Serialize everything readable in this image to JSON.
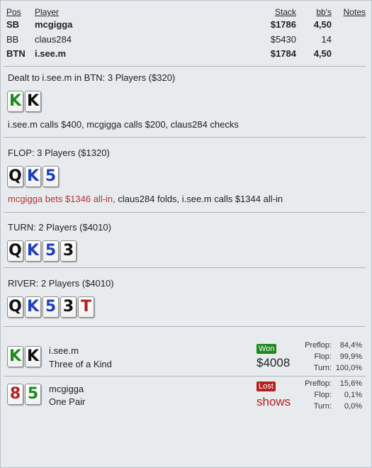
{
  "colors": {
    "spade": "#111111",
    "club": "#1d8a1d",
    "heart": "#b52020",
    "diamond": "#1f41b8",
    "won": "#1d8a1d",
    "lost": "#b52020",
    "red_action": "#b83232"
  },
  "table": {
    "headers": {
      "pos": "Pos",
      "player": "Player",
      "stack": "Stack",
      "bbs": "bb's",
      "notes": "Notes"
    },
    "rows": [
      {
        "pos": "SB",
        "player": "mcgigga",
        "stack": "$1786",
        "bbs": "4,50",
        "bold": true
      },
      {
        "pos": "BB",
        "player": "claus284",
        "stack": "$5430",
        "bbs": "14",
        "bold": false
      },
      {
        "pos": "BTN",
        "player": "i.see.m",
        "stack": "$1784",
        "bbs": "4,50",
        "bold": true
      }
    ]
  },
  "preflop": {
    "title": "Dealt to i.see.m in BTN: 3 Players ($320)",
    "cards": [
      {
        "rank": "K",
        "suit": "club"
      },
      {
        "rank": "K",
        "suit": "spade"
      }
    ],
    "action": "i.see.m calls $400, mcgigga calls $200, claus284 checks"
  },
  "flop": {
    "title": "FLOP: 3 Players ($1320)",
    "cards": [
      {
        "rank": "Q",
        "suit": "spade"
      },
      {
        "rank": "K",
        "suit": "diamond"
      },
      {
        "rank": "5",
        "suit": "diamond"
      }
    ],
    "action_red": "mcgigga bets $1346 all-in,",
    "action_rest": " claus284 folds, i.see.m calls $1344 all-in"
  },
  "turn": {
    "title": "TURN: 2 Players ($4010)",
    "cards": [
      {
        "rank": "Q",
        "suit": "spade"
      },
      {
        "rank": "K",
        "suit": "diamond"
      },
      {
        "rank": "5",
        "suit": "diamond"
      },
      {
        "rank": "3",
        "suit": "spade"
      }
    ]
  },
  "river": {
    "title": "RIVER: 2 Players ($4010)",
    "cards": [
      {
        "rank": "Q",
        "suit": "spade"
      },
      {
        "rank": "K",
        "suit": "diamond"
      },
      {
        "rank": "5",
        "suit": "diamond"
      },
      {
        "rank": "3",
        "suit": "spade"
      },
      {
        "rank": "T",
        "suit": "heart"
      }
    ]
  },
  "summary": [
    {
      "name": "i.see.m",
      "hand": "Three of a Kind",
      "cards": [
        {
          "rank": "K",
          "suit": "club"
        },
        {
          "rank": "K",
          "suit": "spade"
        }
      ],
      "badge": "Won",
      "badge_color": "won",
      "amount": "$4008",
      "amount_color": "#222222",
      "equity": [
        {
          "label": "Preflop:",
          "value": "84,4%"
        },
        {
          "label": "Flop:",
          "value": "99,9%"
        },
        {
          "label": "Turn:",
          "value": "100,0%"
        }
      ]
    },
    {
      "name": "mcgigga",
      "hand": "One Pair",
      "cards": [
        {
          "rank": "8",
          "suit": "heart"
        },
        {
          "rank": "5",
          "suit": "club"
        }
      ],
      "badge": "Lost",
      "badge_color": "lost",
      "amount": "shows",
      "amount_color": "#b52020",
      "equity": [
        {
          "label": "Preflop:",
          "value": "15,6%"
        },
        {
          "label": "Flop:",
          "value": "0,1%"
        },
        {
          "label": "Turn:",
          "value": "0,0%"
        }
      ]
    }
  ]
}
